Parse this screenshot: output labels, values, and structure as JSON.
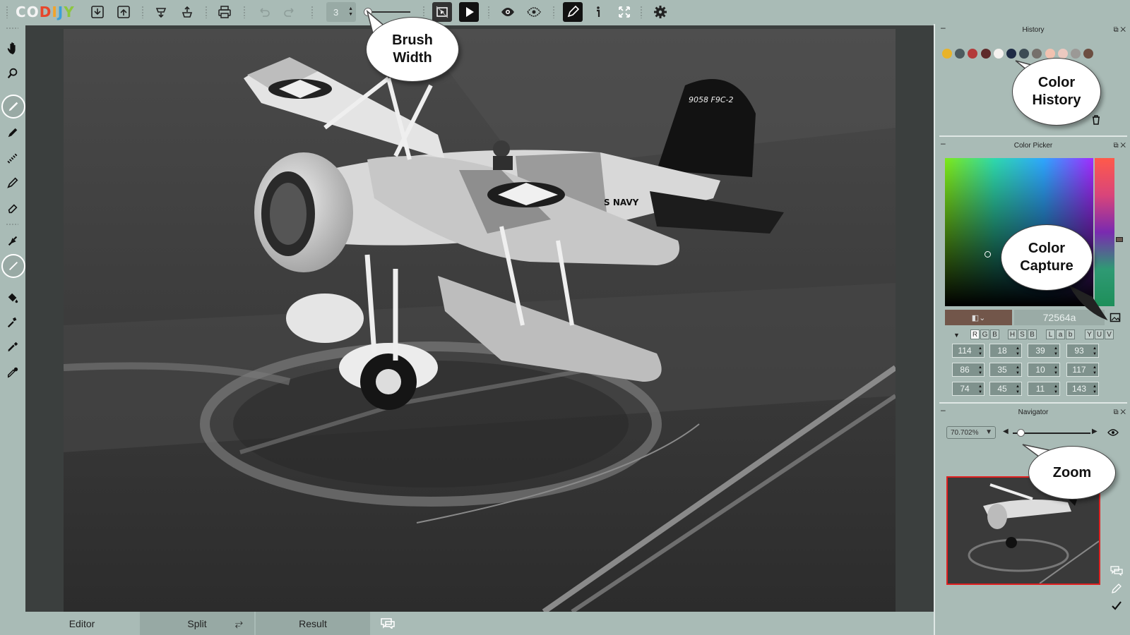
{
  "app": {
    "logo_text": "CODIJY",
    "logo_letters": [
      "C",
      "O",
      "D",
      "I",
      "J",
      "Y"
    ],
    "logo_colors": [
      "#f4f4f4",
      "#f4f4f4",
      "#e7462b",
      "#f2a32a",
      "#3aa0d8",
      "#8cc63f"
    ]
  },
  "toolbar": {
    "buttons": [
      "open-icon",
      "save-icon",
      "import-colors-icon",
      "export-colors-icon",
      "print-icon",
      "undo-icon",
      "redo-icon"
    ],
    "brush_width_value": "3",
    "brush_width_slider": 0.05,
    "view_buttons": [
      "preview-split-icon",
      "play-icon",
      "eye-icon",
      "eye-crossed-icon",
      "pen-mode-icon",
      "info-icon",
      "fullscreen-icon",
      "settings-icon"
    ]
  },
  "left_tools": [
    "hand-icon",
    "zoom-tool-icon",
    "brush-round-icon",
    "pencil-icon",
    "dotted-brush-icon",
    "marker-icon",
    "eraser-icon",
    "smudge-icon",
    "thin-brush-icon",
    "bucket-icon",
    "wand-icon",
    "eyedropper-icon",
    "color-picker-icon"
  ],
  "bottom_tabs": {
    "editor": "Editor",
    "split": "Split",
    "result": "Result"
  },
  "panels": {
    "history": {
      "title": "History",
      "swatches": [
        "#e8b32a",
        "#4d5a5e",
        "#b33a3a",
        "#5e2a2a",
        "#f4f1ef",
        "#1e2b45",
        "#3d4c55",
        "#75706b",
        "#f2c2b0",
        "#ecc9c0",
        "#9b9996",
        "#6c4e41"
      ]
    },
    "color_picker": {
      "title": "Color Picker",
      "hex_value": "72564a",
      "current_color": "#72564a",
      "channel_groups": [
        [
          "R",
          "G",
          "B"
        ],
        [
          "H",
          "S",
          "B"
        ],
        [
          "L",
          "a",
          "b"
        ],
        [
          "Y",
          "U",
          "V"
        ]
      ],
      "selected_channel": "R",
      "values": [
        [
          "114",
          "18",
          "39",
          "93"
        ],
        [
          "86",
          "35",
          "10",
          "117"
        ],
        [
          "74",
          "45",
          "11",
          "143"
        ]
      ]
    },
    "navigator": {
      "title": "Navigator",
      "zoom_value": "70.702%",
      "zoom_slider": 0.1
    }
  },
  "callouts": {
    "brush_width": "Brush\nWidth",
    "color_history": "Color\nHistory",
    "color_capture": "Color\nCapture",
    "zoom": "Zoom"
  }
}
